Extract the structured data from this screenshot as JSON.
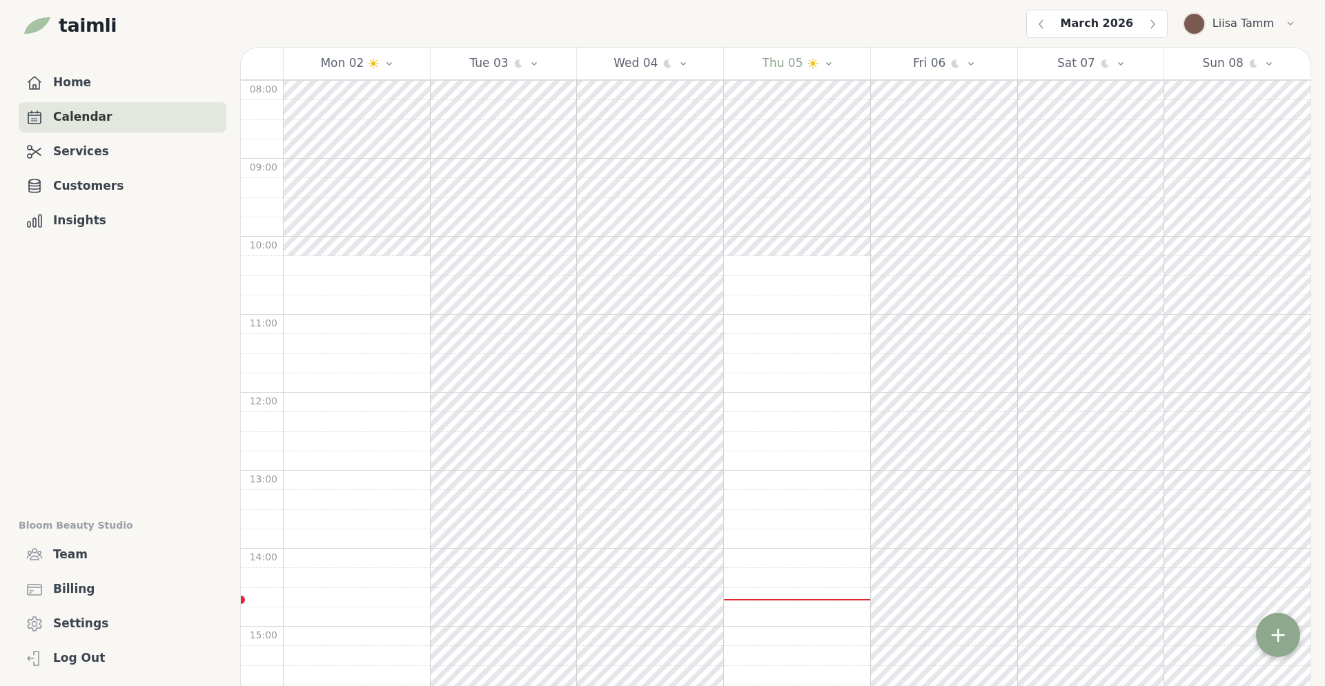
{
  "brand": {
    "name": "taimli"
  },
  "sidebar": {
    "items": [
      {
        "label": "Home",
        "selected": false
      },
      {
        "label": "Calendar",
        "selected": true
      },
      {
        "label": "Services",
        "selected": false
      },
      {
        "label": "Customers",
        "selected": false
      },
      {
        "label": "Insights",
        "selected": false
      }
    ],
    "section_title": "Bloom Beauty Studio",
    "footer_items": [
      {
        "label": "Team"
      },
      {
        "label": "Billing"
      },
      {
        "label": "Settings"
      },
      {
        "label": "Log Out"
      }
    ]
  },
  "header": {
    "month": "March 2026",
    "user": {
      "name": "Liisa Tamm"
    }
  },
  "calendar": {
    "days": [
      {
        "label": "Mon 02",
        "kind": "sun",
        "today": false,
        "open": true
      },
      {
        "label": "Tue 03",
        "kind": "moon",
        "today": false,
        "open": false
      },
      {
        "label": "Wed 04",
        "kind": "moon",
        "today": false,
        "open": false
      },
      {
        "label": "Thu 05",
        "kind": "sun",
        "today": true,
        "open": true
      },
      {
        "label": "Fri 06",
        "kind": "moon",
        "today": false,
        "open": false
      },
      {
        "label": "Sat 07",
        "kind": "moon",
        "today": false,
        "open": false
      },
      {
        "label": "Sun 08",
        "kind": "moon",
        "today": false,
        "open": false
      }
    ],
    "hours": [
      "08:00",
      "09:00",
      "10:00",
      "11:00",
      "12:00",
      "13:00",
      "14:00",
      "15:00"
    ]
  },
  "fab": {
    "label": "+"
  }
}
